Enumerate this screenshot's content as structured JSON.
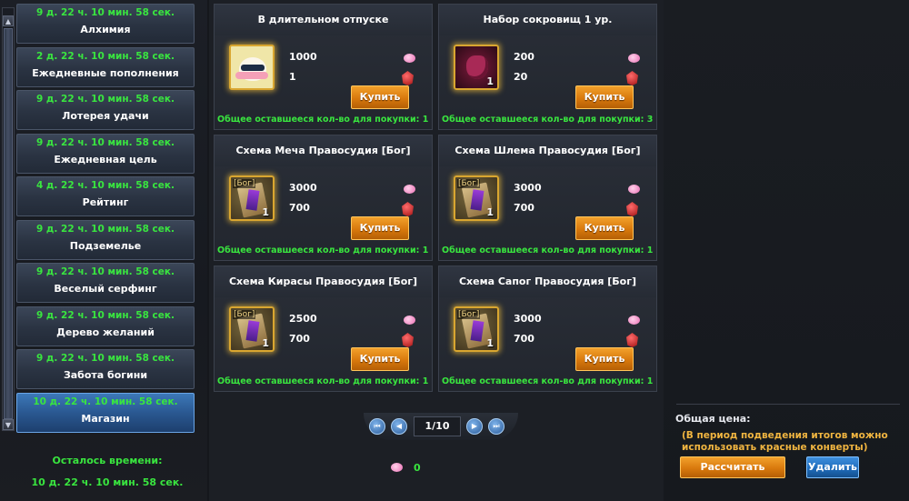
{
  "sidebar": {
    "items": [
      {
        "timer": "9 д. 22 ч. 10 мин. 58 сек.",
        "label": "Алхимия"
      },
      {
        "timer": "2 д. 22 ч. 10 мин. 58 сек.",
        "label": "Ежедневные пополнения"
      },
      {
        "timer": "9 д. 22 ч. 10 мин. 58 сек.",
        "label": "Лотерея удачи"
      },
      {
        "timer": "9 д. 22 ч. 10 мин. 58 сек.",
        "label": "Ежедневная цель"
      },
      {
        "timer": "4 д. 22 ч. 10 мин. 58 сек.",
        "label": "Рейтинг"
      },
      {
        "timer": "9 д. 22 ч. 10 мин. 58 сек.",
        "label": "Подземелье"
      },
      {
        "timer": "9 д. 22 ч. 10 мин. 58 сек.",
        "label": "Веселый серфинг"
      },
      {
        "timer": "9 д. 22 ч. 10 мин. 58 сек.",
        "label": "Дерево желаний"
      },
      {
        "timer": "9 д. 22 ч. 10 мин. 58 сек.",
        "label": "Забота богини"
      },
      {
        "timer": "10 д. 22 ч. 10 мин. 58 сек.",
        "label": "Магазин"
      }
    ],
    "active_index": 9,
    "remaining_title": "Осталось времени:",
    "remaining_value": "10 д. 22 ч. 10 мин. 58 сек."
  },
  "shop": {
    "cards": [
      {
        "title": "В длительном отпуске",
        "icon": "cat-sunglasses-icon",
        "qty": "",
        "tag": "",
        "price_pink": "1000",
        "price_ruby": "1",
        "buy_label": "Купить",
        "remain": "Общее оставшееся кол-во для покупки: 1"
      },
      {
        "title": "Набор сокровищ 1 ур.",
        "icon": "treasure-chest-icon",
        "qty": "1",
        "tag": "",
        "price_pink": "200",
        "price_ruby": "20",
        "buy_label": "Купить",
        "remain": "Общее оставшееся кол-во для покупки: 3"
      },
      {
        "title": "Схема Меча Правосудия [Бог]",
        "icon": "scroll-icon",
        "qty": "1",
        "tag": "[Бог]",
        "price_pink": "3000",
        "price_ruby": "700",
        "buy_label": "Купить",
        "remain": "Общее оставшееся кол-во для покупки: 1"
      },
      {
        "title": "Схема Шлема Правосудия [Бог]",
        "icon": "scroll-icon",
        "qty": "1",
        "tag": "[Бог]",
        "price_pink": "3000",
        "price_ruby": "700",
        "buy_label": "Купить",
        "remain": "Общее оставшееся кол-во для покупки: 1"
      },
      {
        "title": "Схема Кирасы Правосудия [Бог]",
        "icon": "scroll-icon",
        "qty": "1",
        "tag": "[Бог]",
        "price_pink": "2500",
        "price_ruby": "700",
        "buy_label": "Купить",
        "remain": "Общее оставшееся кол-во для покупки: 1"
      },
      {
        "title": "Схема Сапог Правосудия [Бог]",
        "icon": "scroll-icon",
        "qty": "1",
        "tag": "[Бог]",
        "price_pink": "3000",
        "price_ruby": "700",
        "buy_label": "Купить",
        "remain": "Общее оставшееся кол-во для покупки: 1"
      }
    ],
    "pager": {
      "label": "1/10"
    },
    "wallet": {
      "pink_gems": "0"
    }
  },
  "summary": {
    "total_label": "Общая цена:",
    "note": "(В период подведения итогов можно использовать красные конверты)",
    "calc_label": "Рассчитать",
    "delete_label": "Удалить"
  },
  "colors": {
    "timer_green": "#39e53f",
    "accent_orange": "#d8790d",
    "accent_blue": "#1f6cbc",
    "note_gold": "#f0b540"
  }
}
